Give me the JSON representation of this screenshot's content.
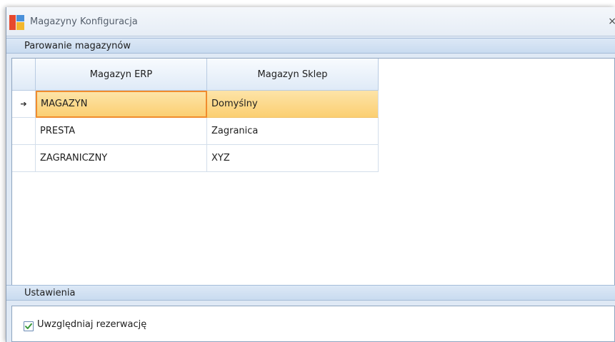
{
  "window": {
    "title": "Magazyny Konfiguracja",
    "close_glyph": "×"
  },
  "pairing_section": {
    "title": "Parowanie magazynów"
  },
  "grid": {
    "columns": [
      "Magazyn ERP",
      "Magazyn Sklep"
    ],
    "selected_row_indicator": "➔",
    "rows": [
      {
        "erp": "MAGAZYN",
        "sklep": "Domyślny"
      },
      {
        "erp": "PRESTA",
        "sklep": "Zagranica"
      },
      {
        "erp": "ZAGRANICZNY",
        "sklep": "XYZ"
      }
    ]
  },
  "settings_section": {
    "title": "Ustawienia",
    "reservation_checkbox": {
      "label": "Uwzględniaj rezerwację",
      "checked": true
    }
  },
  "colors": {
    "selection": "#fbcf72",
    "focus_border": "#f08c2d",
    "check": "#3a9a3a"
  },
  "icons": {
    "app": "app-logo-icon",
    "row_indicator": "arrow-right-icon",
    "check": "checkmark-icon"
  }
}
